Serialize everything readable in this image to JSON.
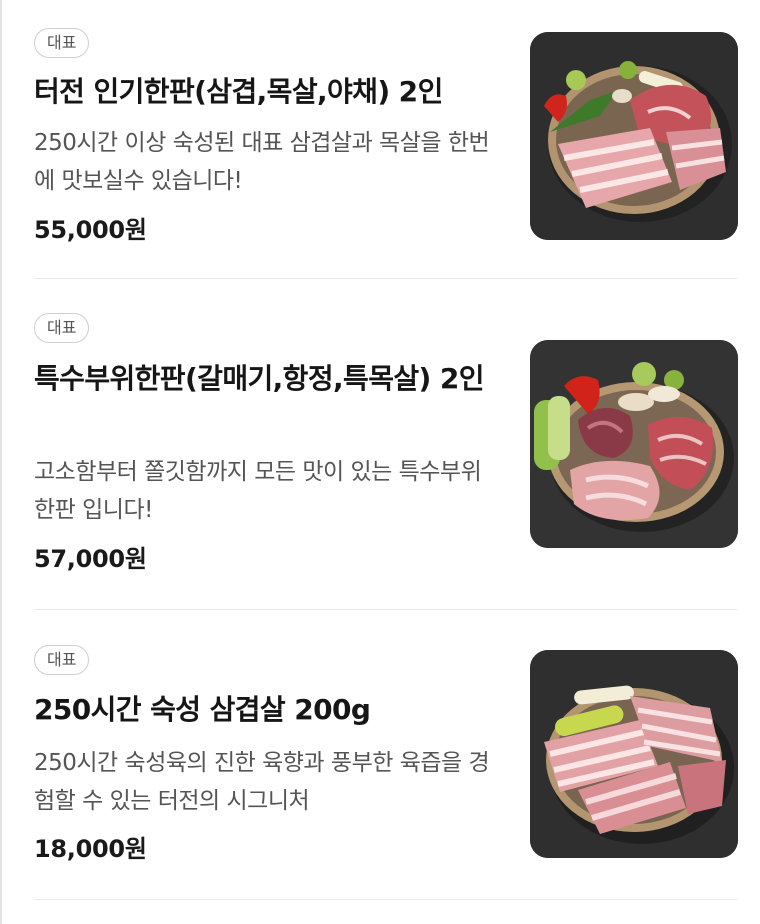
{
  "menu": {
    "items": [
      {
        "badge": "대표",
        "title": "터전 인기한판(삼겹,목살,야채) 2인",
        "description": "250시간 이상 숙성된 대표 삼겹살과 목살을 한번에 맛보실수 있습니다!",
        "price": "55,000원",
        "image_icon": "pork-platter-image"
      },
      {
        "badge": "대표",
        "title": "특수부위한판(갈매기,항정,특목살) 2인",
        "description": "고소함부터 쫄깃함까지 모든 맛이 있는 특수부위 한판 입니다!",
        "price": "57,000원",
        "image_icon": "pork-platter-image"
      },
      {
        "badge": "대표",
        "title": "250시간 숙성 삼겹살 200g",
        "description": "250시간 숙성육의 진한 육향과 풍부한 육즙을 경험할 수 있는 터전의 시그니처",
        "price": "18,000원",
        "image_icon": "pork-platter-image"
      }
    ]
  }
}
